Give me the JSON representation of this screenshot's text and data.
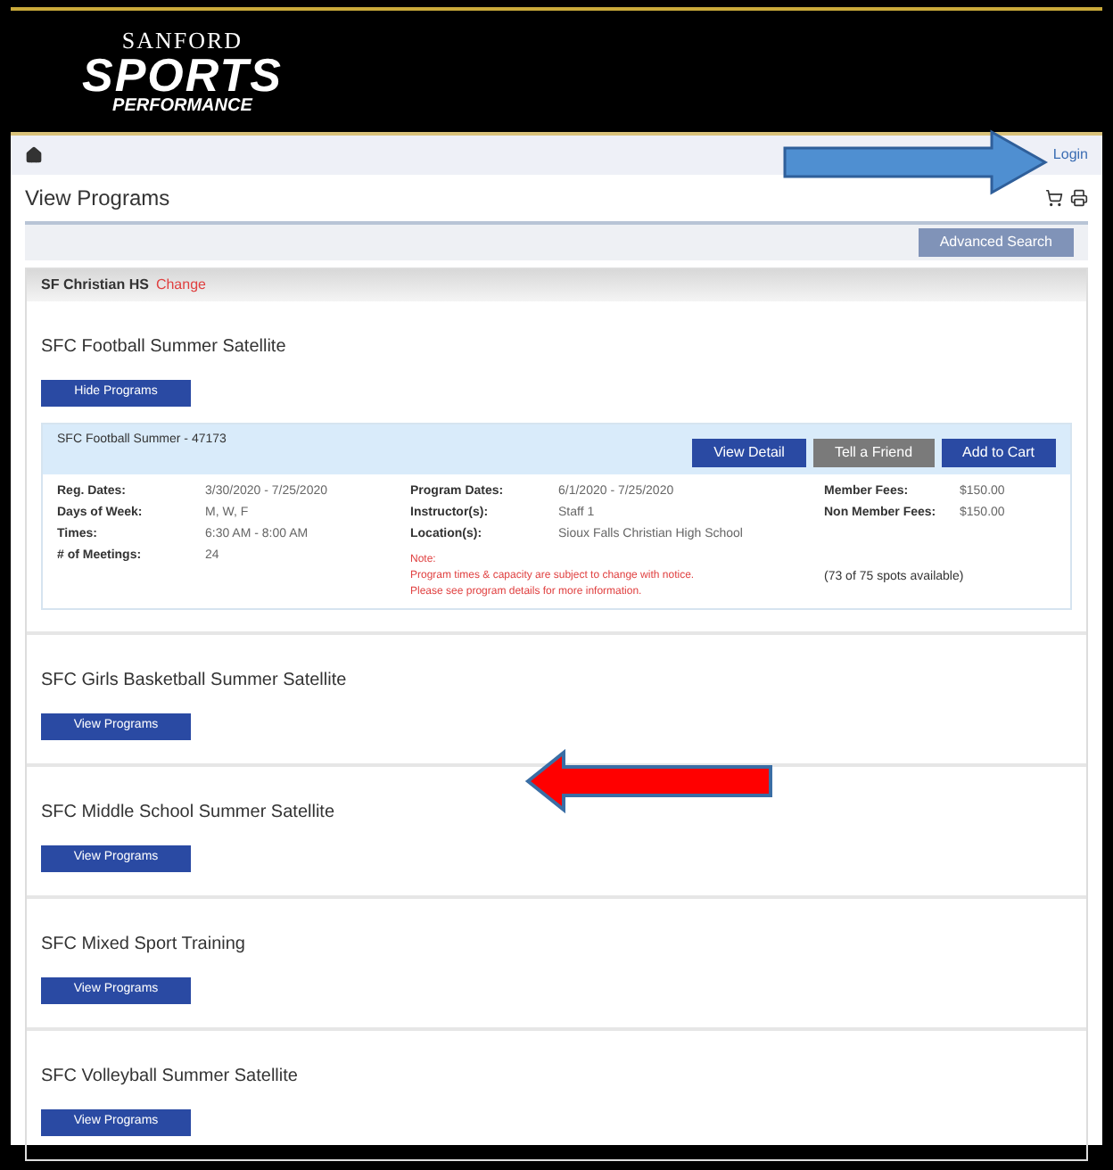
{
  "logo": {
    "top": "SANFORD",
    "main": "SPORTS",
    "bottom": "PERFORMANCE"
  },
  "nav": {
    "login": "Login"
  },
  "page": {
    "title": "View Programs",
    "advanced_search": "Advanced Search"
  },
  "location": {
    "name": "SF Christian HS",
    "change": "Change"
  },
  "categories": [
    {
      "title": "SFC Football Summer Satellite",
      "button": "Hide Programs",
      "program": {
        "name": "SFC Football Summer - 47173",
        "buttons": [
          {
            "label": "View Detail",
            "kind": "primary"
          },
          {
            "label": "Tell a Friend",
            "kind": "secondary"
          },
          {
            "label": "Add to Cart",
            "kind": "primary"
          }
        ],
        "left": [
          {
            "label": "Reg. Dates:",
            "value": "3/30/2020 - 7/25/2020"
          },
          {
            "label": "Days of Week:",
            "value": "M, W, F"
          },
          {
            "label": "Times:",
            "value": "6:30 AM - 8:00 AM"
          },
          {
            "label": "# of Meetings:",
            "value": "24"
          }
        ],
        "middle": [
          {
            "label": "Program Dates:",
            "value": "6/1/2020 - 7/25/2020"
          },
          {
            "label": "Instructor(s):",
            "value": "Staff 1"
          },
          {
            "label": "Location(s):",
            "value": "Sioux Falls Christian High School"
          }
        ],
        "right": [
          {
            "label": "Member Fees:",
            "value": "$150.00"
          },
          {
            "label": "Non Member Fees:",
            "value": "$150.00"
          }
        ],
        "notes": [
          "Note:",
          "Program times & capacity are subject to change with notice.",
          "Please see program details for more information."
        ],
        "availability": "(73 of 75 spots available)"
      }
    },
    {
      "title": "SFC Girls Basketball Summer Satellite",
      "button": "View Programs"
    },
    {
      "title": "SFC Middle School Summer Satellite",
      "button": "View Programs"
    },
    {
      "title": "SFC Mixed Sport Training",
      "button": "View Programs"
    },
    {
      "title": "SFC Volleyball Summer Satellite",
      "button": "View Programs"
    }
  ]
}
